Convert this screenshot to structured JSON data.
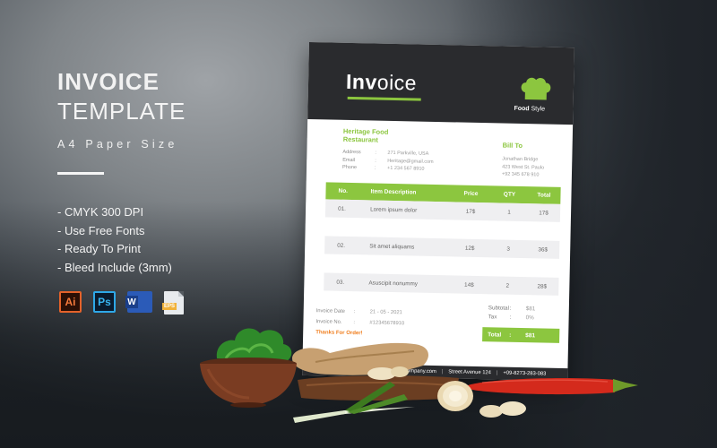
{
  "promo": {
    "title_line1": "INVOICE",
    "title_line2": "TEMPLATE",
    "subtitle": "A4 Paper Size",
    "features": [
      "- CMYK 300 DPI",
      "- Use Free Fonts",
      "- Ready To Print",
      "- Bleed Include (3mm)"
    ],
    "apps": [
      {
        "name": "illustrator-icon",
        "label": "Ai"
      },
      {
        "name": "photoshop-icon",
        "label": "Ps"
      },
      {
        "name": "word-icon",
        "label": "W"
      },
      {
        "name": "eps-file-icon",
        "label": "EPS"
      }
    ]
  },
  "invoice": {
    "title_bold": "Inv",
    "title_rest": "oice",
    "brand_bold": "Food",
    "brand_rest": " Style",
    "from": {
      "name": "Heritage Food Restaurant",
      "fields": [
        {
          "label": "Address",
          "value": "271 Parkville, USA"
        },
        {
          "label": "Email",
          "value": "Heritage@gmail.com"
        },
        {
          "label": "Phone",
          "value": "+1 234 567 8910"
        }
      ]
    },
    "bill_to": {
      "title": "Bill To",
      "lines": [
        "Jonathan Bridge",
        "423 West St. Paulo",
        "+92 345 678 910"
      ]
    },
    "table": {
      "headers": [
        "No.",
        "Item Description",
        "Price",
        "QTY",
        "Total"
      ],
      "rows": [
        {
          "no": "01.",
          "desc": "Lorem ipsum dolor",
          "price": "17$",
          "qty": "1",
          "total": "17$"
        },
        {
          "no": "02.",
          "desc": "Sit amet aliquams",
          "price": "12$",
          "qty": "3",
          "total": "36$"
        },
        {
          "no": "03.",
          "desc": "Asuscipit nonummy",
          "price": "14$",
          "qty": "2",
          "total": "28$"
        }
      ]
    },
    "meta": [
      {
        "label": "Invoice Date",
        "value": "21 - 05 - 2021"
      },
      {
        "label": "Invoice No.",
        "value": "#12345678910"
      }
    ],
    "thanks": "Thanks For Order!",
    "summary": [
      {
        "label": "Subtotal",
        "value": "$81"
      },
      {
        "label": "Tax",
        "value": "0%"
      }
    ],
    "total": {
      "label": "Total",
      "value": "$81"
    },
    "footer": [
      "company.com",
      "Street Avenue 124",
      "+09-8273-283-083"
    ],
    "colors": {
      "accent": "#8cc63f",
      "dark": "#2a2b2e",
      "thanks": "#f07e1e"
    }
  },
  "colon": ":"
}
